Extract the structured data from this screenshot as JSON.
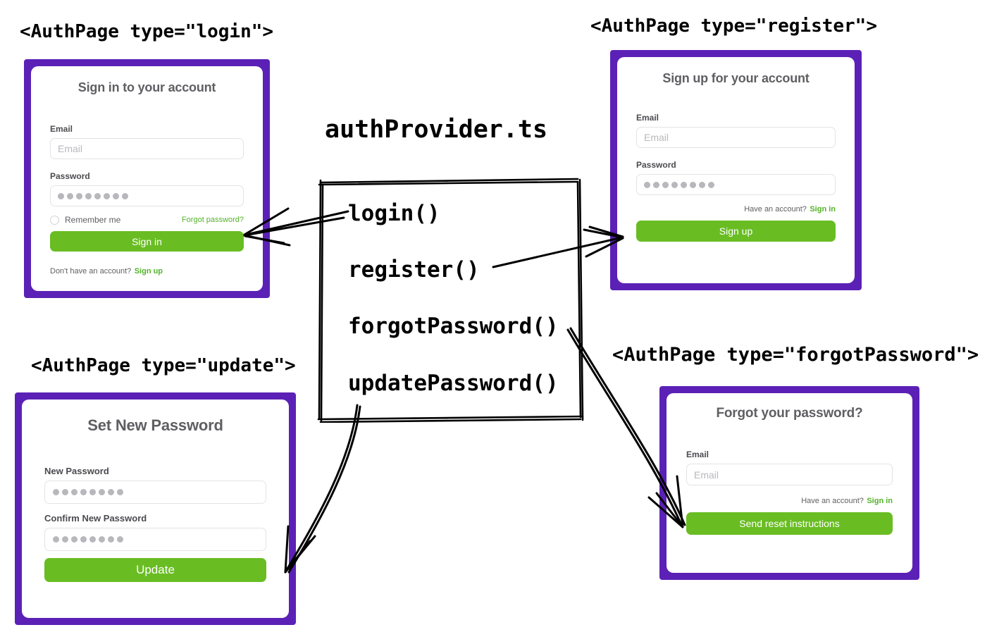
{
  "diagram": {
    "provider_title": "authProvider.ts",
    "functions": [
      {
        "name": "login()"
      },
      {
        "name": "register()"
      },
      {
        "name": "forgotPassword()"
      },
      {
        "name": "updatePassword()"
      }
    ]
  },
  "login_page": {
    "tag": "<AuthPage type=\"login\">",
    "title": "Sign in to your account",
    "email_label": "Email",
    "email_placeholder": "Email",
    "password_label": "Password",
    "password_value": "●●●●●●●●",
    "password_dots": 8,
    "remember_label": "Remember me",
    "forgot_link": "Forgot password?",
    "submit_label": "Sign in",
    "footer_text": "Don't have an account?",
    "footer_link": "Sign up"
  },
  "register_page": {
    "tag": "<AuthPage type=\"register\">",
    "title": "Sign up for your account",
    "email_label": "Email",
    "email_placeholder": "Email",
    "password_label": "Password",
    "password_dots": 8,
    "footer_text": "Have an account?",
    "footer_link": "Sign in",
    "submit_label": "Sign up"
  },
  "update_page": {
    "tag": "<AuthPage type=\"update\">",
    "title": "Set New Password",
    "new_password_label": "New Password",
    "new_password_dots": 8,
    "confirm_password_label": "Confirm New Password",
    "confirm_password_dots": 8,
    "submit_label": "Update"
  },
  "forgot_page": {
    "tag": "<AuthPage type=\"forgotPassword\">",
    "title": "Forgot your password?",
    "email_label": "Email",
    "email_placeholder": "Email",
    "footer_text": "Have an account?",
    "footer_link": "Sign in",
    "submit_label": "Send reset instructions"
  },
  "colors": {
    "frame_purple": "#5b21b6",
    "button_green": "#69bd23",
    "link_green": "#52b32a",
    "title_gray": "#5f5f63",
    "ink_black": "#000000",
    "page_background": "#ffffff"
  }
}
